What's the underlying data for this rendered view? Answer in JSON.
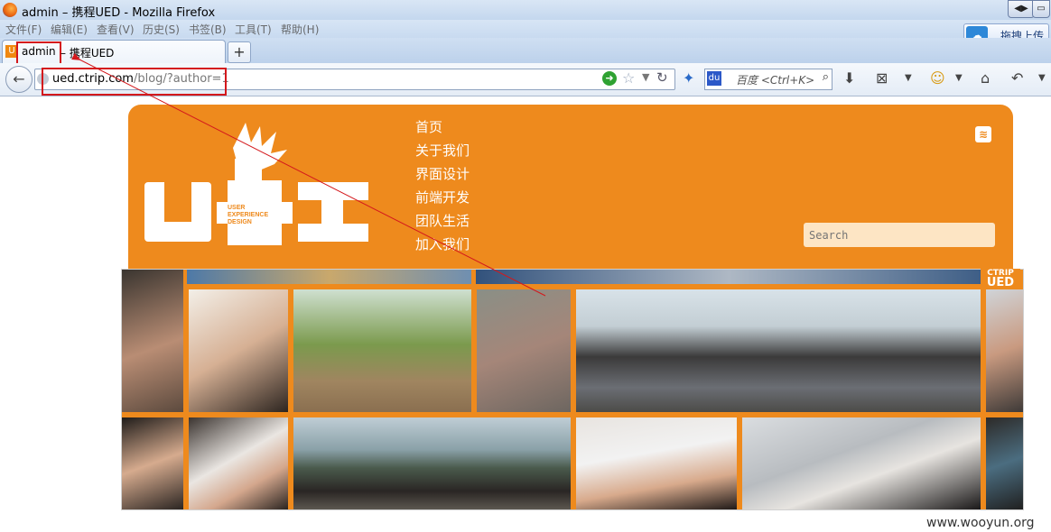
{
  "window": {
    "title": "admin – 携程UED - Mozilla Firefox",
    "btn_left": "◀▶",
    "btn_right": "▭"
  },
  "menu": [
    "文件(F)",
    "编辑(E)",
    "查看(V)",
    "历史(S)",
    "书签(B)",
    "工具(T)",
    "帮助(H)"
  ],
  "upload_label": "拖拽上传",
  "tab": {
    "part1": "admin",
    "part2": "– 携程UED",
    "new_tab": "+"
  },
  "url": {
    "host": "ued.ctrip.com",
    "path": "/blog/?author=1"
  },
  "search_bar": {
    "placeholder": "百度 <Ctrl+K>"
  },
  "site": {
    "nav": [
      "首页",
      "关于我们",
      "界面设计",
      "前端开发",
      "团队生活",
      "加入我们"
    ],
    "search_placeholder": "Search",
    "logo_sub": [
      "USER",
      "EXPERIENCE",
      "DESIGN"
    ],
    "banner_tag": [
      "CTRIP",
      "UED"
    ]
  },
  "watermark": "www.wooyun.org",
  "colors": {
    "accent": "#ee8a1d",
    "highlight": "#d4181c"
  }
}
